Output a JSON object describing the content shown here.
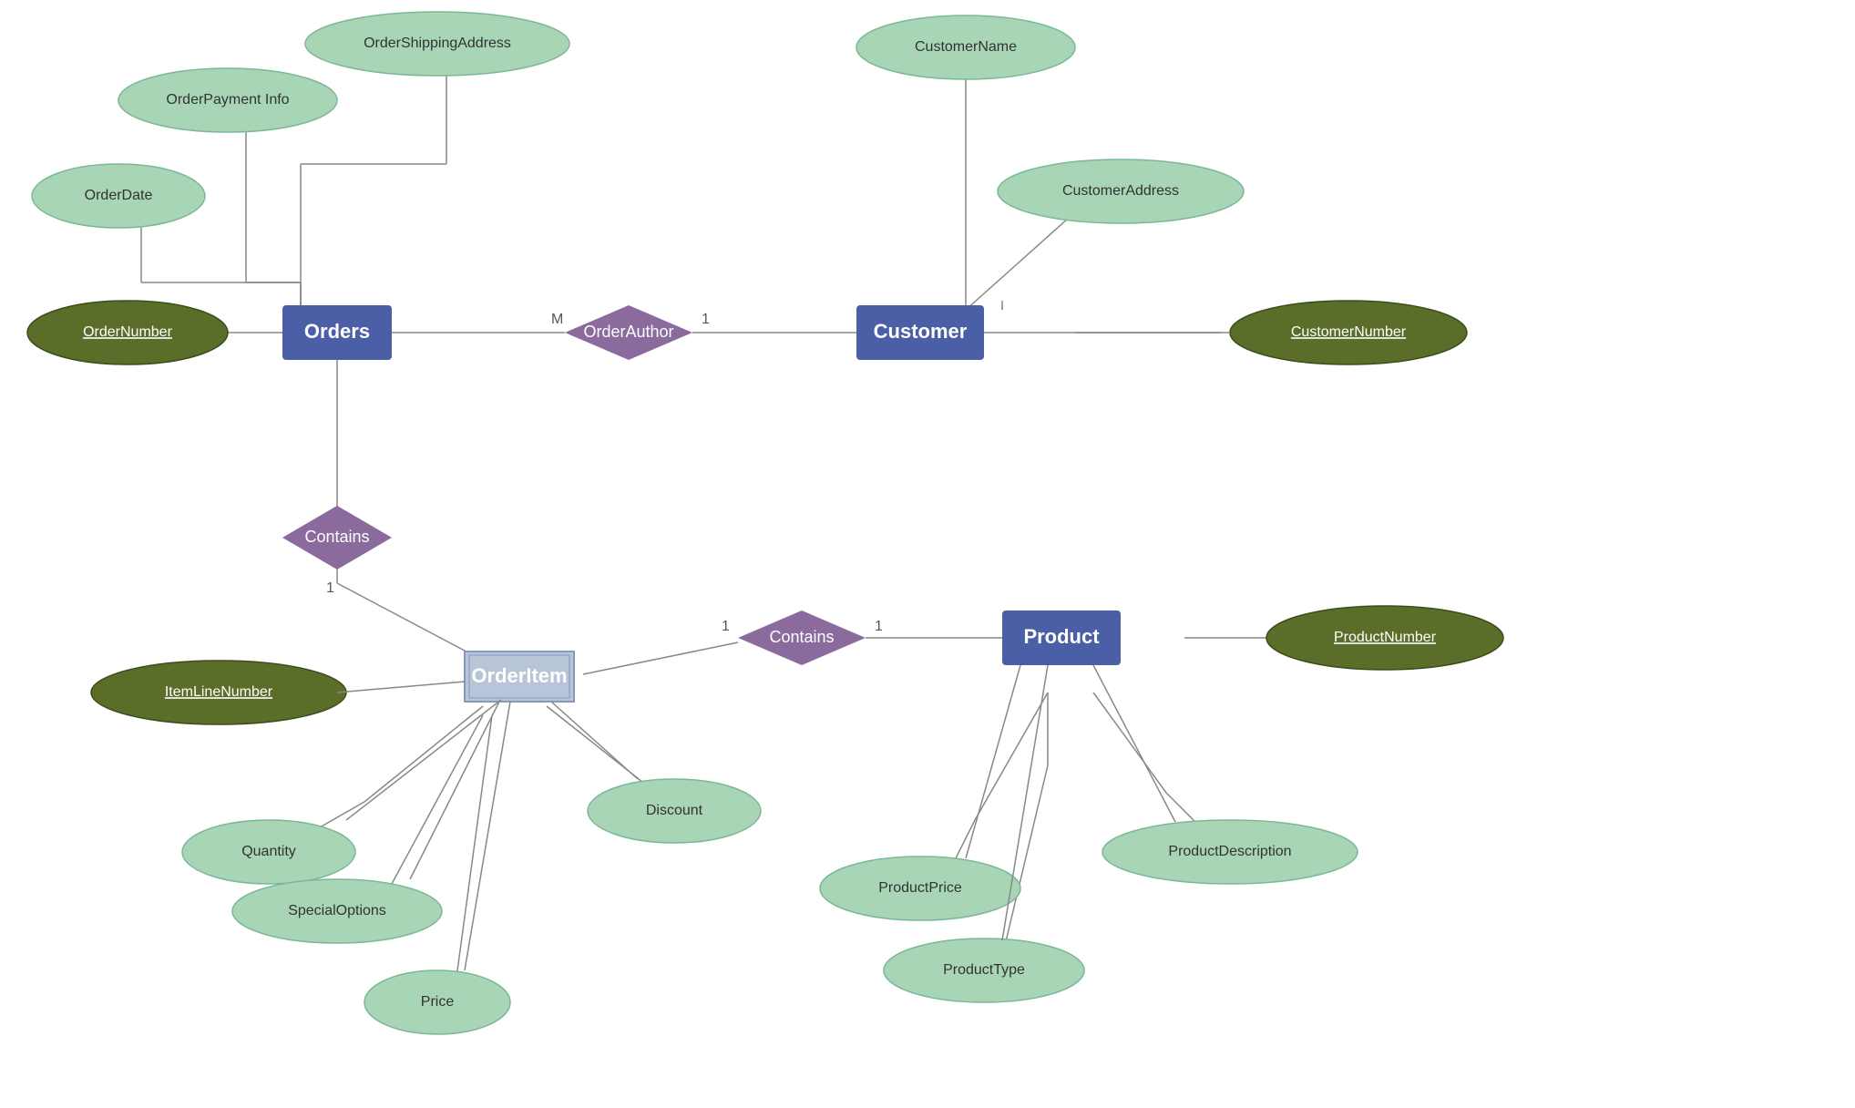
{
  "entities": {
    "orders": "Orders",
    "customer": "Customer",
    "product": "Product",
    "orderItem": "OrderItem"
  },
  "relations": {
    "orderAuthor": "OrderAuthor",
    "contains1": "Contains",
    "contains2": "Contains"
  },
  "attrs": {
    "orderDate": "OrderDate",
    "orderPaymentInfo": "OrderPayment Info",
    "orderShippingAddress": "OrderShippingAddress",
    "orderNumber": "OrderNumber",
    "customerName": "CustomerName",
    "customerAddress": "CustomerAddress",
    "customerNumber": "CustomerNumber",
    "itemLineNumber": "ItemLineNumber",
    "quantity": "Quantity",
    "specialOptions": "SpecialOptions",
    "price": "Price",
    "discount": "Discount",
    "productNumber": "ProductNumber",
    "productPrice": "ProductPrice",
    "productDescription": "ProductDescription",
    "productType": "ProductType"
  },
  "cardinality": {
    "mLabel": "M",
    "oneLabel": "1"
  }
}
